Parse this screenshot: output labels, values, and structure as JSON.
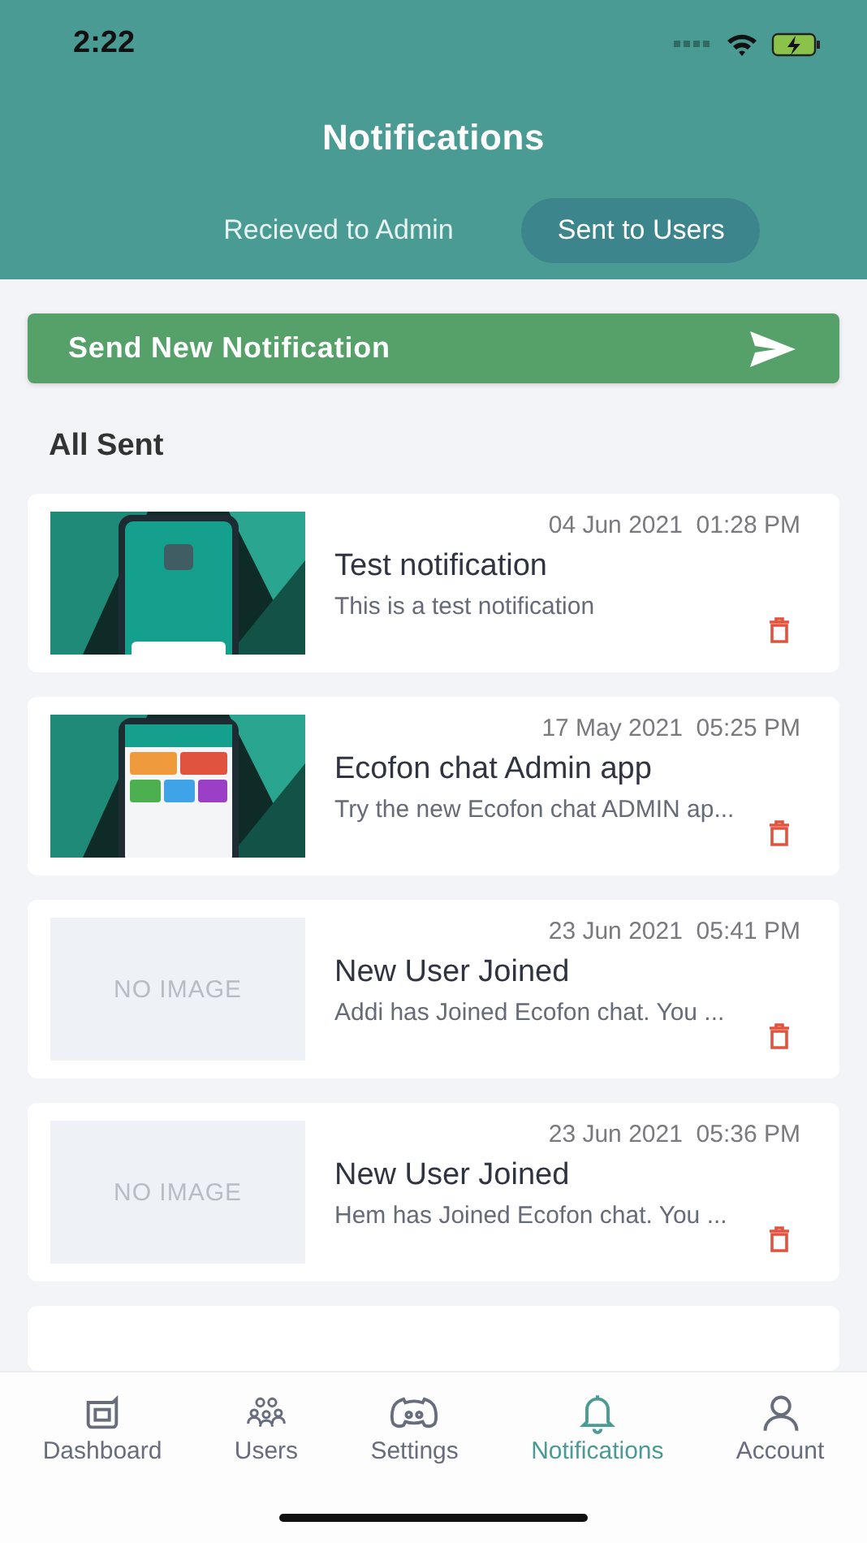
{
  "status_bar": {
    "time": "2:22"
  },
  "header": {
    "title": "Notifications"
  },
  "tabs": [
    {
      "label": "Recieved to Admin",
      "selected": false
    },
    {
      "label": "Sent to Users",
      "selected": true
    }
  ],
  "send_button": {
    "label": "Send New Notification"
  },
  "section_title": "All Sent",
  "notifications": [
    {
      "date": "04 Jun 2021",
      "time": "01:28 PM",
      "title": "Test notification",
      "message": "This is a test notification"
    },
    {
      "date": "17 May 2021",
      "time": "05:25 PM",
      "title": "Ecofon chat Admin app",
      "message": "Try the new Ecofon chat ADMIN ap..."
    },
    {
      "image": {
        "kind": "none",
        "text": "NO IMAGE"
      },
      "date": "23 Jun 2021",
      "time": "05:41 PM",
      "title": "New User Joined",
      "message": "Addi has Joined Ecofon chat. You ..."
    },
    {
      "image": {
        "kind": "none",
        "text": "NO IMAGE"
      },
      "date": "23 Jun 2021",
      "time": "05:36 PM",
      "title": "New User Joined",
      "message": "Hem has Joined Ecofon chat. You ..."
    }
  ],
  "bottom_nav": [
    {
      "label": "Dashboard",
      "kind": "dashboard",
      "selected": false
    },
    {
      "label": "Users",
      "kind": "users",
      "selected": false
    },
    {
      "label": "Settings",
      "kind": "settings",
      "selected": false
    },
    {
      "label": "Notifications",
      "kind": "bell",
      "selected": true
    },
    {
      "label": "Account",
      "kind": "account",
      "selected": false
    }
  ]
}
